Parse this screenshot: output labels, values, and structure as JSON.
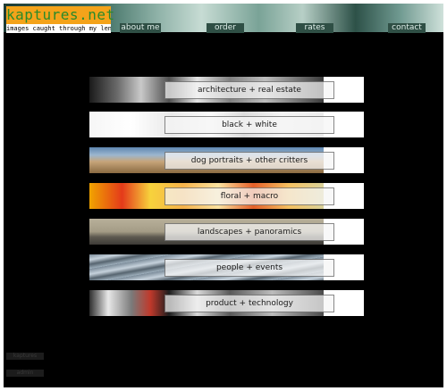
{
  "site": {
    "logo": "kaptures.net",
    "tagline": "images caught through my lens"
  },
  "nav": [
    {
      "label": "about me"
    },
    {
      "label": "order"
    },
    {
      "label": "rates"
    },
    {
      "label": "contact"
    }
  ],
  "galleries": [
    {
      "label": "architecture + real estate"
    },
    {
      "label": "black + white"
    },
    {
      "label": "dog portraits + other critters"
    },
    {
      "label": "floral + macro"
    },
    {
      "label": "landscapes + panoramics"
    },
    {
      "label": "people + events"
    },
    {
      "label": "product + technology"
    }
  ],
  "footer": [
    {
      "label": "kaptures"
    },
    {
      "label": "admin"
    }
  ]
}
